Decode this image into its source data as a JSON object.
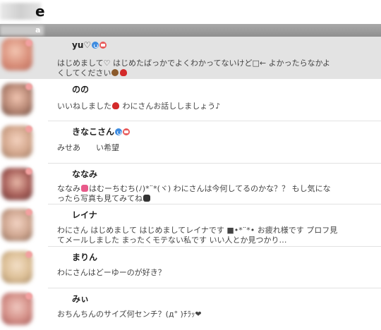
{
  "header": {
    "title_fragment": "e"
  },
  "bar": {
    "label_fragment": "a"
  },
  "conversations": [
    {
      "name": "yu♡",
      "message": "はじめまして♡ はじめたばっかでよくわかってないけど□← よかったらなかよくしてください",
      "selected": true,
      "has_call": true,
      "has_video": true,
      "trailing_emoji": [
        "see-no-evil-monkey",
        "red-heart"
      ]
    },
    {
      "name": "のの",
      "message_before": "いいねしました",
      "message_after": " わにさんお話ししましょう♪",
      "inline_emoji": [
        "red-heart"
      ]
    },
    {
      "name": "きなこさん",
      "message": "みせあ　　い希望",
      "has_call": true,
      "has_video": true
    },
    {
      "name": "ななみ",
      "message_before": "ななみ",
      "message_after": "はむーちむち(ﾉ)*¨*(ヾ) わにさんは今何してるのかな？？ もし気になったら写真も見てみてね",
      "inline_emoji": [
        "kissing-face",
        "camera"
      ]
    },
    {
      "name": "レイナ",
      "message": "わにさん はじめまして はじめましてレイナです ■•*¨*• お疲れ様です プロフ見てメールしました まったくモテない私です いい人とか見つかり…"
    },
    {
      "name": "まりん",
      "message": "わにさんはどーゆーのが好き？"
    },
    {
      "name": "みぃ",
      "message": "おちんちんのサイズ何センチ？(д° )ﾁﾗｯ❤"
    }
  ]
}
